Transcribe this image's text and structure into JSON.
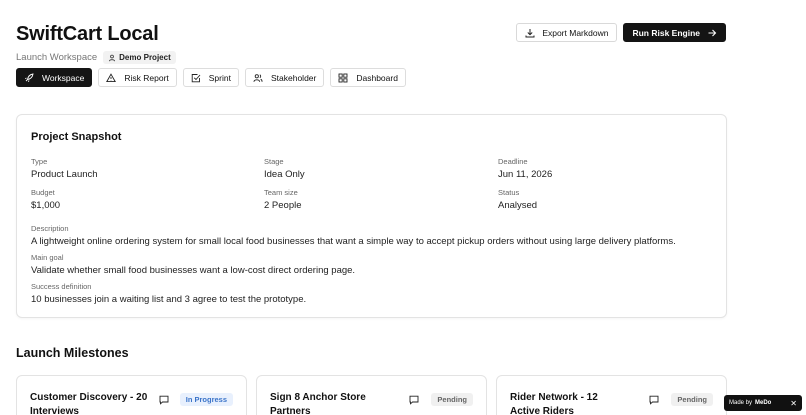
{
  "header": {
    "title": "SwiftCart Local",
    "subtitle": "Launch Workspace",
    "badge": "Demo Project"
  },
  "actions": {
    "export_label": "Export Markdown",
    "run_label": "Run Risk Engine"
  },
  "tabs": [
    {
      "label": "Workspace",
      "icon": "rocket-icon",
      "active": true
    },
    {
      "label": "Risk Report",
      "icon": "warning-triangle-icon",
      "active": false
    },
    {
      "label": "Sprint",
      "icon": "checkbox-icon",
      "active": false
    },
    {
      "label": "Stakeholder",
      "icon": "users-icon",
      "active": false
    },
    {
      "label": "Dashboard",
      "icon": "grid-icon",
      "active": false
    }
  ],
  "snapshot": {
    "title": "Project Snapshot",
    "type": {
      "label": "Type",
      "value": "Product Launch"
    },
    "stage": {
      "label": "Stage",
      "value": "Idea Only"
    },
    "deadline": {
      "label": "Deadline",
      "value": "Jun 11, 2026"
    },
    "budget": {
      "label": "Budget",
      "value": "$1,000"
    },
    "team_size": {
      "label": "Team size",
      "value": "2 People"
    },
    "status": {
      "label": "Status",
      "value": "Analysed"
    },
    "description": {
      "label": "Description",
      "value": "A lightweight online ordering system for small local food businesses that want a simple way to accept pickup orders without using large delivery platforms."
    },
    "main_goal": {
      "label": "Main goal",
      "value": "Validate whether small food businesses want a low-cost direct ordering page."
    },
    "success": {
      "label": "Success definition",
      "value": "10 businesses join a waiting list and 3 agree to test the prototype."
    }
  },
  "milestones": {
    "title": "Launch Milestones",
    "items": [
      {
        "title": "Customer Discovery - 20 Interviews",
        "status": "In Progress"
      },
      {
        "title": "Sign 8 Anchor Store Partners",
        "status": "Pending"
      },
      {
        "title": "Rider Network - 12 Active Riders",
        "status": "Pending"
      }
    ]
  },
  "made_by": {
    "prefix": "Made by",
    "brand": "MeDo",
    "close": "✕"
  },
  "colors": {
    "accent_dark": "#141414",
    "in_progress": "#3b74c9",
    "pending": "#666666"
  }
}
